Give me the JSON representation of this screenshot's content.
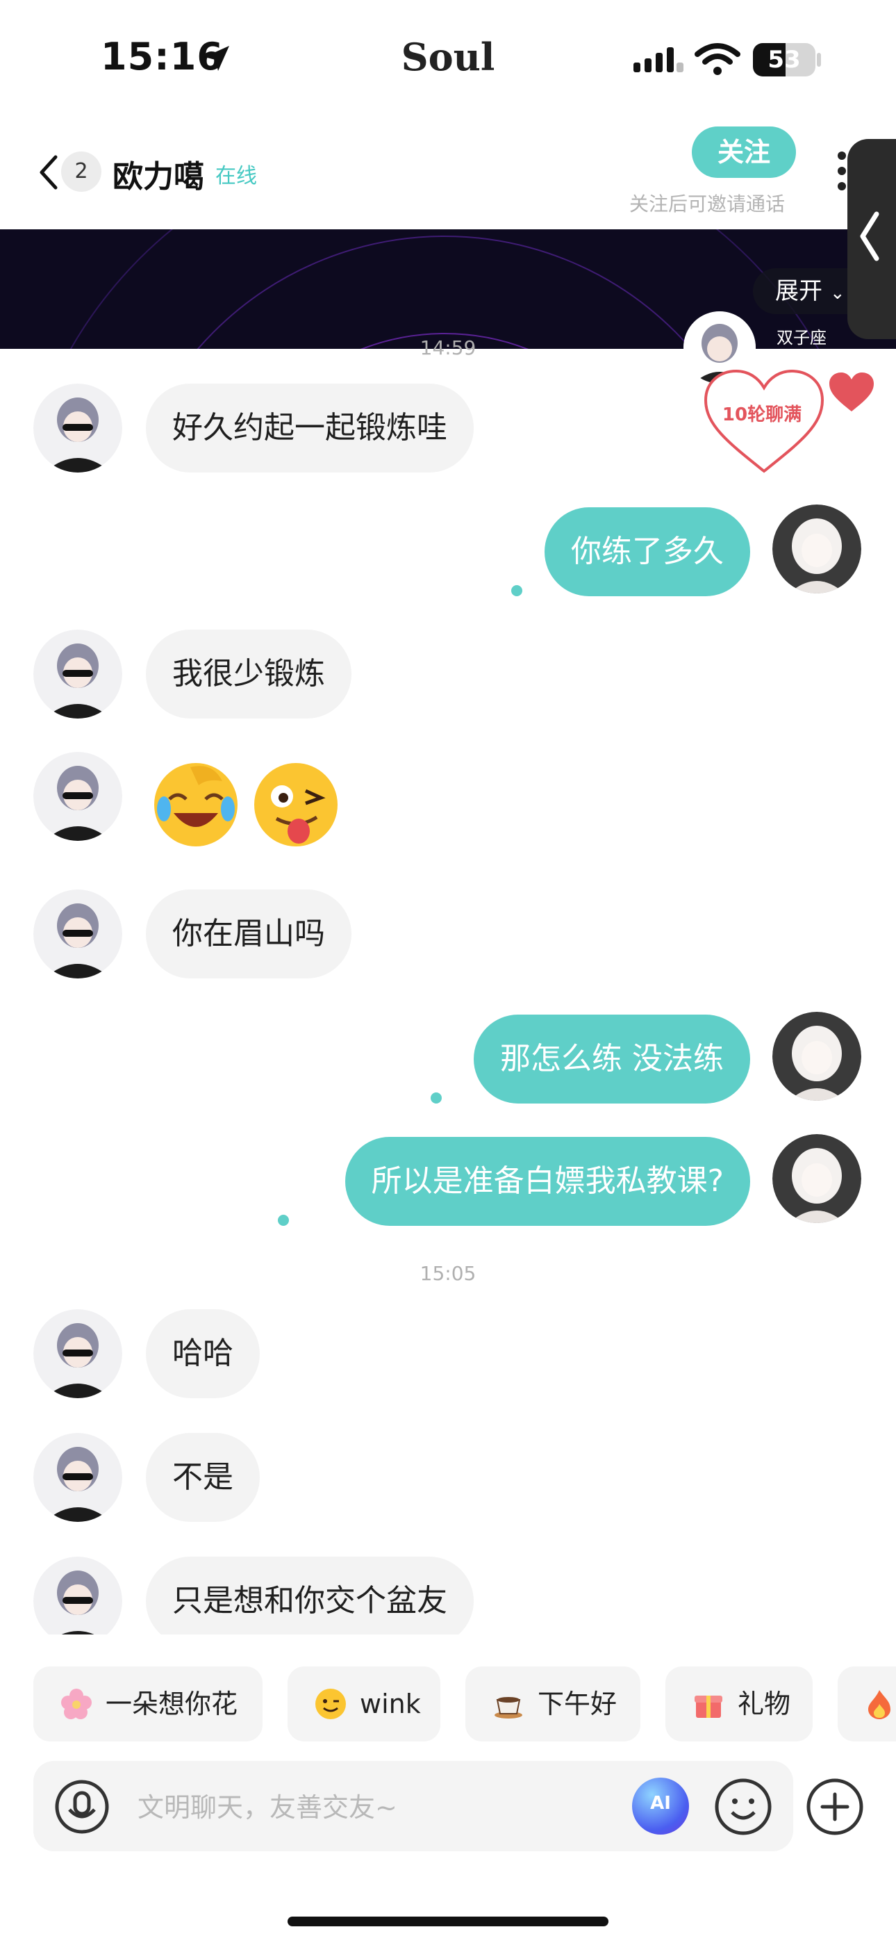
{
  "status_bar": {
    "time": "15:16",
    "app_brand": "Soul",
    "battery": "53"
  },
  "header": {
    "unread_count": "2",
    "contact_name": "欧力噶",
    "contact_status": "在线",
    "follow_label": "关注",
    "follow_hint": "关注后可邀请通话"
  },
  "banner": {
    "expand_label": "展开",
    "zodiac": "双子座"
  },
  "intimacy": {
    "label": "10轮聊满"
  },
  "messages": [
    {
      "side": "left",
      "type": "text",
      "text": "好久约起一起锻炼哇"
    },
    {
      "side": "right",
      "type": "text",
      "text": "你练了多久"
    },
    {
      "side": "left",
      "type": "text",
      "text": "我很少锻炼"
    },
    {
      "side": "left",
      "type": "emoji",
      "icons": [
        "crying-laughing-emoji",
        "zany-face-emoji"
      ]
    },
    {
      "side": "left",
      "type": "text",
      "text": "你在眉山吗"
    },
    {
      "side": "right",
      "type": "text",
      "text": "那怎么练 没法练"
    },
    {
      "side": "right",
      "type": "text",
      "text": "所以是准备白嫖我私教课?"
    },
    {
      "side": "left",
      "type": "text",
      "text": "哈哈"
    },
    {
      "side": "left",
      "type": "text",
      "text": "不是"
    },
    {
      "side": "left",
      "type": "text",
      "text": "只是想和你交个盆友"
    }
  ],
  "timestamps": [
    "14:59",
    "15:05"
  ],
  "quick_replies": [
    {
      "label": "一朵想你花",
      "icon": "cherry-blossom-icon"
    },
    {
      "label": "wink",
      "icon": "wink-face-icon"
    },
    {
      "label": "下午好",
      "icon": "coffee-cup-icon"
    },
    {
      "label": "礼物",
      "icon": "gift-icon"
    },
    {
      "label": "",
      "icon": "fire-icon"
    }
  ],
  "input": {
    "placeholder": "文明聊天，友善交友~",
    "ai_label": "AI"
  },
  "colors": {
    "accent": "#5fcfc8",
    "bubble_left": "#f3f3f3",
    "heart": "#e3545c"
  }
}
